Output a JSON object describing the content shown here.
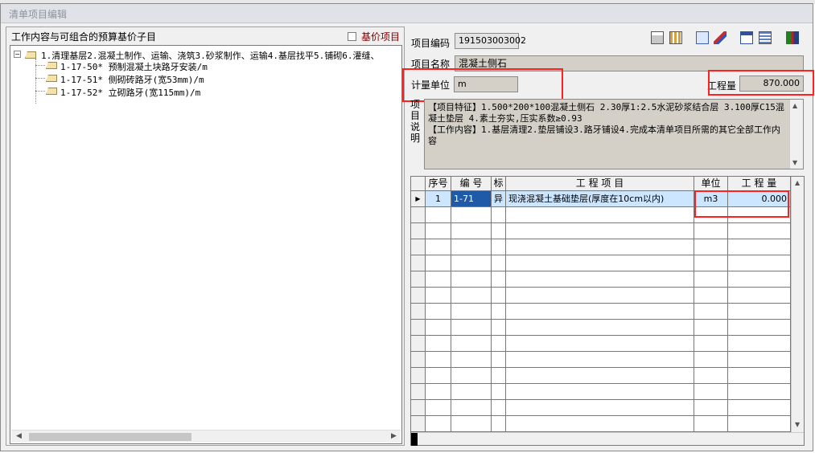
{
  "window": {
    "title": "清单项目编辑"
  },
  "left": {
    "group_title": "工作内容与可组合的预算基价子目",
    "checkbox_label": "基价项目",
    "tree": {
      "root": "1.清理基层2.混凝土制作、运输、浇筑3.砂浆制作、运输4.基层找平5.铺砌6.灌缝、",
      "children": [
        "1-17-50* 预制混凝土块路牙安装/m",
        "1-17-51* 侧砌砖路牙(宽53mm)/m",
        "1-17-52* 立砌路牙(宽115mm)/m"
      ]
    }
  },
  "right": {
    "code_label": "项目编码",
    "code_value": "191503003002",
    "name_label": "项目名称",
    "name_value": "混凝土侧石",
    "unit_label": "计量单位",
    "unit_value": "m",
    "qty_label": "工程量",
    "qty_value": "870.000",
    "desc_label": [
      "项",
      "目",
      "说",
      "明"
    ],
    "desc_text": "【项目特征】1.500*200*100混凝土侧石 2.30厚1:2.5水泥砂浆结合层 3.100厚C15混凝土垫层 4.素土夯实,压实系数≥0.93\n【工作内容】1.基层清理2.垫层铺设3.路牙铺设4.完成本清单项目所需的其它全部工作内容"
  },
  "grid": {
    "headers": {
      "seq": "序号",
      "code": "编 号",
      "flag": "标",
      "item": "工 程 项 目",
      "unit": "单位",
      "qty": "工 程 量"
    },
    "rows": [
      {
        "seq": "1",
        "code": "1-71",
        "flag": "异",
        "item": "现浇混凝土基础垫层(厚度在10cm以内)",
        "unit": "m3",
        "qty": "0.000"
      }
    ]
  },
  "icons": [
    "calculator-icon",
    "grid-icon",
    "replace-icon",
    "edit-icon",
    "window-icon",
    "table-settings-icon",
    "exit-icon"
  ],
  "colors": {
    "highlight_red": "#ff2020",
    "selected_row": "#cde6ff",
    "field_bg": "#d4d0c8"
  }
}
